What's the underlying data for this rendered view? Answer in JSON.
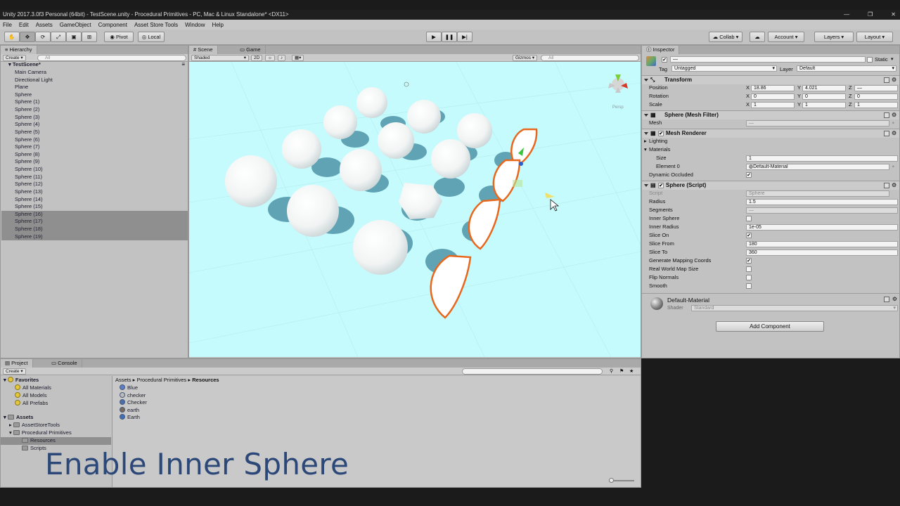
{
  "window": {
    "title": "Unity 2017.3.0f3 Personal (64bit) - TestScene.unity - Procedural Primitives - PC, Mac & Linux Standalone* <DX11>",
    "controls": [
      "—",
      "❐",
      "✕"
    ]
  },
  "menu": [
    "File",
    "Edit",
    "Assets",
    "GameObject",
    "Component",
    "Asset Store Tools",
    "Window",
    "Help"
  ],
  "toolbar": {
    "pivot_label": "Pivot",
    "local_label": "Local",
    "collab_label": "Collab ▾",
    "account_label": "Account",
    "layers_label": "Layers",
    "layout_label": "Layout"
  },
  "hierarchy": {
    "tab_label": "Hierarchy",
    "create_label": "Create ▾",
    "search_placeholder": "All",
    "scene_name": "TestScene*",
    "items": [
      "Main Camera",
      "Directional Light",
      "Plane",
      "Sphere",
      "Sphere (1)",
      "Sphere (2)",
      "Sphere (3)",
      "Sphere (4)",
      "Sphere (5)",
      "Sphere (6)",
      "Sphere (7)",
      "Sphere (8)",
      "Sphere (9)",
      "Sphere (10)",
      "Sphere (11)",
      "Sphere (12)",
      "Sphere (13)",
      "Sphere (14)",
      "Sphere (15)",
      "Sphere (16)",
      "Sphere (17)",
      "Sphere (18)",
      "Sphere (19)"
    ],
    "selected_from_index": 19
  },
  "scene_view": {
    "tab_scene": "Scene",
    "tab_game": "Game",
    "shading_mode": "Shaded",
    "mode_2d": "2D",
    "gizmos_label": "Gizmos ▾",
    "search_placeholder": "All",
    "persp_label": "Persp",
    "sky_color": "#c5fbfc",
    "selection_color": "#e8671d"
  },
  "inspector": {
    "tab_label": "Inspector",
    "static_label": "Static",
    "tag_label": "Tag",
    "tag_value": "Untagged",
    "layer_label": "Layer",
    "layer_value": "Default",
    "transform": {
      "title": "Transform",
      "position_label": "Position",
      "rotation_label": "Rotation",
      "scale_label": "Scale",
      "position": {
        "x": "18.86",
        "y": "4.021",
        "z": "—"
      },
      "rotation": {
        "x": "0",
        "y": "0",
        "z": "0"
      },
      "scale": {
        "x": "1",
        "y": "1",
        "z": "1"
      }
    },
    "mesh_filter": {
      "title": "Sphere (Mesh Filter)",
      "mesh_label": "Mesh",
      "mesh_value": "—"
    },
    "mesh_renderer": {
      "title": "Mesh Renderer",
      "lighting_label": "Lighting",
      "materials_label": "Materials",
      "size_label": "Size",
      "size_value": "1",
      "element0_label": "Element 0",
      "element0_value": "Default-Material",
      "dynamic_occluded_label": "Dynamic Occluded"
    },
    "sphere_script": {
      "title": "Sphere (Script)",
      "script_label": "Script",
      "script_value": "Sphere",
      "radius_label": "Radius",
      "radius_value": "1.5",
      "segments_label": "Segments",
      "segments_value": "—",
      "inner_sphere_label": "Inner Sphere",
      "inner_radius_label": "Inner Radius",
      "inner_radius_value": "1e-05",
      "slice_on_label": "Slice On",
      "slice_from_label": "Slice From",
      "slice_from_value": "180",
      "slice_to_label": "Slice To",
      "slice_to_value": "360",
      "gen_mapping_label": "Generate Mapping Coords",
      "real_world_label": "Real World Map Size",
      "flip_normals_label": "Flip Normals",
      "smooth_label": "Smooth"
    },
    "material": {
      "name": "Default-Material",
      "shader_label": "Shader",
      "shader_value": "Standard"
    },
    "add_component_label": "Add Component"
  },
  "project": {
    "tab_project": "Project",
    "tab_console": "Console",
    "create_label": "Create ▾",
    "favorites_label": "Favorites",
    "favorites": [
      "All Materials",
      "All Models",
      "All Prefabs"
    ],
    "assets_label": "Assets",
    "folders": [
      "AssetStoreTools",
      "Procedural Primitives",
      "Resources",
      "Scripts"
    ],
    "breadcrumb": [
      "Assets",
      "Procedural Primitives",
      "Resources"
    ],
    "files": [
      {
        "name": "Blue",
        "color": "#5a7fc8"
      },
      {
        "name": "checker",
        "color": "#bbbbbb"
      },
      {
        "name": "Checker",
        "color": "#4d6fa8"
      },
      {
        "name": "earth",
        "color": "#7a6a5a"
      },
      {
        "name": "Earth",
        "color": "#3f6fb5"
      }
    ]
  },
  "caption": "Enable Inner Sphere"
}
